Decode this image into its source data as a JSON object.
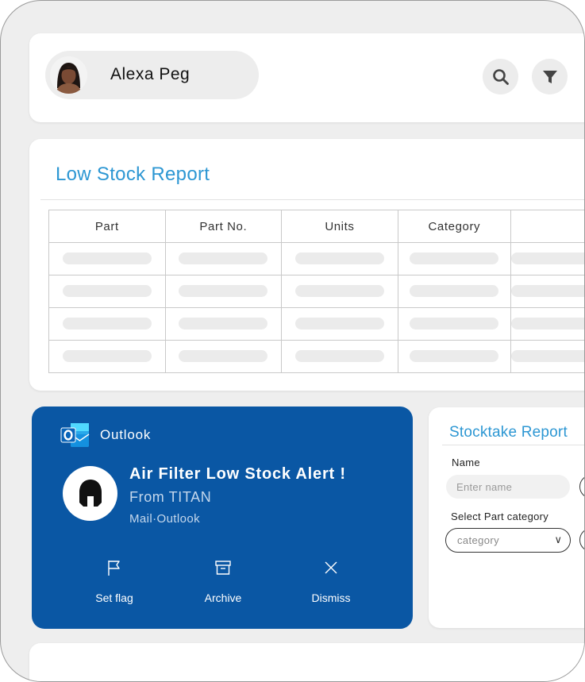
{
  "user": {
    "name": "Alexa Peg"
  },
  "header": {
    "search_icon": "search-icon",
    "filter_icon": "filter-icon"
  },
  "low_stock_report": {
    "title": "Low Stock Report",
    "columns": [
      "Part",
      "Part No.",
      "Units",
      "Category",
      ""
    ]
  },
  "notification": {
    "app": "Outlook",
    "title": "Air Filter Low Stock Alert !",
    "from": "From TITAN",
    "meta": "Mail·Outlook",
    "actions": [
      {
        "label": "Set flag",
        "icon": "flag-icon"
      },
      {
        "label": "Archive",
        "icon": "archive-icon"
      },
      {
        "label": "Dismiss",
        "icon": "close-icon"
      }
    ],
    "colors": {
      "background": "#0a57a4"
    }
  },
  "stocktake_report": {
    "title": "Stocktake Report",
    "name_label": "Name",
    "name_placeholder": "Enter name",
    "category_label": "Select Part category",
    "category_value": "category"
  },
  "colors": {
    "accent": "#2d97d3",
    "page_bg": "#eeeeee"
  }
}
